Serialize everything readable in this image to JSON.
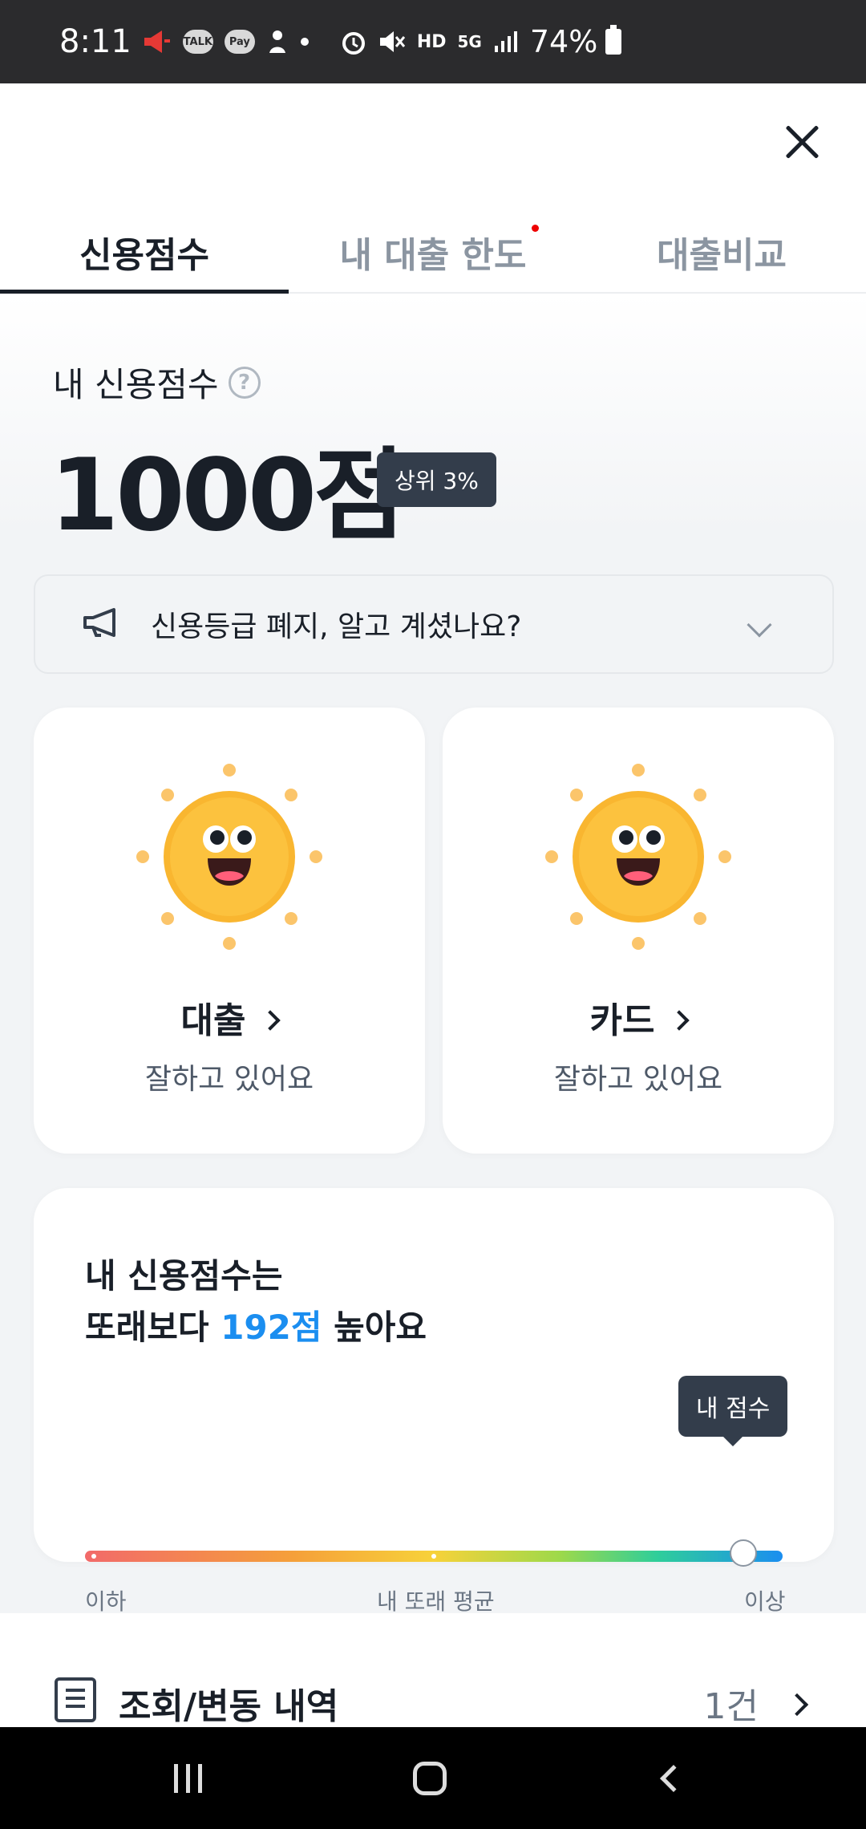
{
  "status_bar": {
    "time": "8:11",
    "battery": "74%",
    "icons": [
      "megaphone-icon",
      "talk-icon",
      "pay-icon",
      "app-icon",
      "dot-icon",
      "alarm-icon",
      "mute-icon",
      "hd-voice-icon",
      "5g-icon",
      "signal-icon",
      "battery-icon"
    ],
    "talk_label": "TALK",
    "pay_label": "Pay",
    "hd_label": "HD",
    "fiveg_label": "5G"
  },
  "tabs": [
    {
      "label": "신용점수",
      "active": true
    },
    {
      "label": "내 대출 한도",
      "active": false,
      "has_dot": true
    },
    {
      "label": "대출비교",
      "active": false
    }
  ],
  "score": {
    "label": "내 신용점수",
    "value": "1000점",
    "rank": "상위 3%"
  },
  "notice": {
    "text": "신용등급 폐지, 알고 계셨나요?"
  },
  "cards": [
    {
      "title": "대출",
      "subtitle": "잘하고 있어요"
    },
    {
      "title": "카드",
      "subtitle": "잘하고 있어요"
    }
  ],
  "comparison": {
    "line1": "내 신용점수는",
    "line2_prefix": "또래보다 ",
    "highlight": "192점",
    "line2_suffix": " 높아요",
    "tooltip": "내 점수",
    "label_low": "이하",
    "label_mid": "내 또래 평균",
    "label_high": "이상",
    "my_position_fraction": 1.0
  },
  "history": {
    "title": "조회/변동 내역",
    "count": "1건"
  },
  "colors": {
    "accent_blue": "#1b8ef0",
    "badge_dark": "#333d4b",
    "sun_orange": "#f7a823"
  }
}
